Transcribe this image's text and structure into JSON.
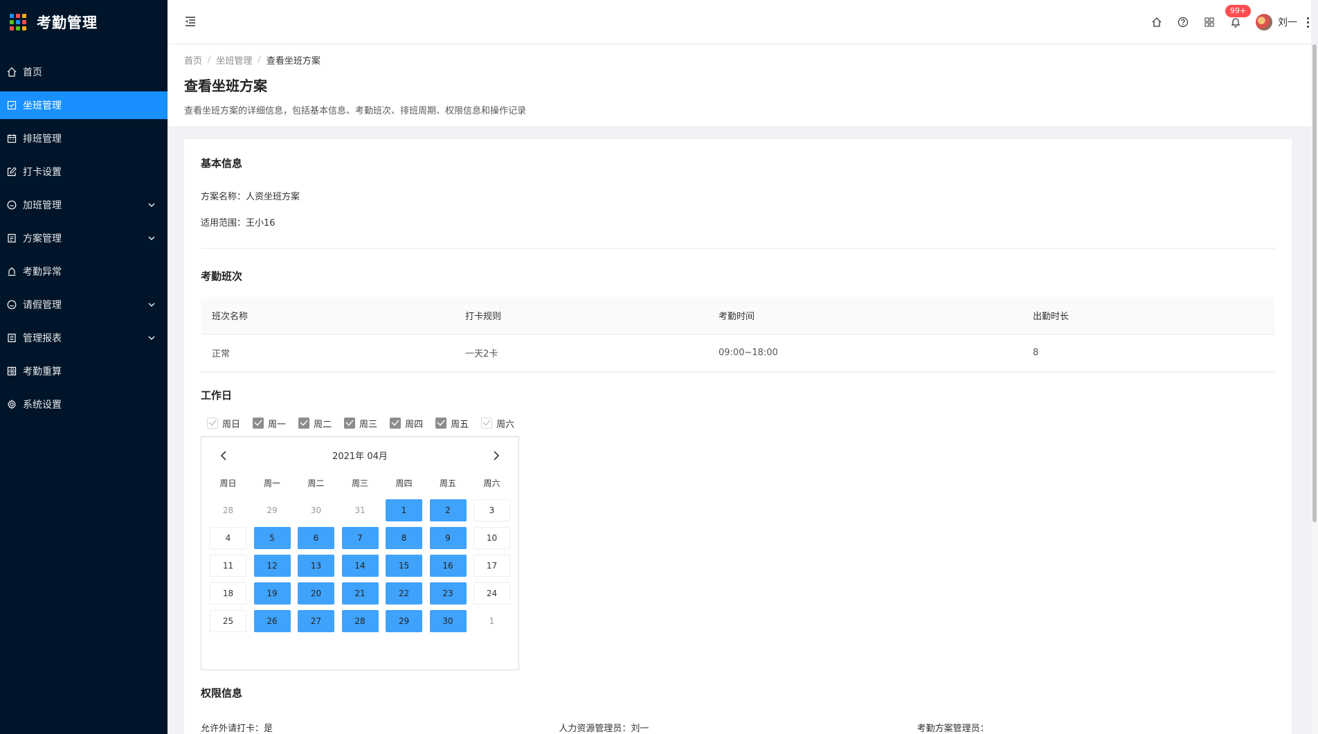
{
  "app": {
    "title": "考勤管理"
  },
  "sidebar": {
    "items": [
      {
        "label": "首页",
        "icon": "home-icon",
        "active": false,
        "has_arrow": false
      },
      {
        "label": "坐班管理",
        "icon": "check-square-icon",
        "active": true,
        "has_arrow": false
      },
      {
        "label": "排班管理",
        "icon": "calendar-icon",
        "active": false,
        "has_arrow": false
      },
      {
        "label": "打卡设置",
        "icon": "edit-icon",
        "active": false,
        "has_arrow": false
      },
      {
        "label": "加班管理",
        "icon": "clock-icon",
        "active": false,
        "has_arrow": true
      },
      {
        "label": "方案管理",
        "icon": "document-icon",
        "active": false,
        "has_arrow": true
      },
      {
        "label": "考勤异常",
        "icon": "alarm-icon",
        "active": false,
        "has_arrow": false
      },
      {
        "label": "请假管理",
        "icon": "smile-icon",
        "active": false,
        "has_arrow": true
      },
      {
        "label": "管理报表",
        "icon": "report-icon",
        "active": false,
        "has_arrow": true
      },
      {
        "label": "考勤重算",
        "icon": "calculator-icon",
        "active": false,
        "has_arrow": false
      },
      {
        "label": "系统设置",
        "icon": "gear-icon",
        "active": false,
        "has_arrow": false
      }
    ]
  },
  "header": {
    "notifications_badge": "99+",
    "username": "刘一"
  },
  "breadcrumb": {
    "home": "首页",
    "parent": "坐班管理",
    "current": "查看坐班方案",
    "separator": "/"
  },
  "page": {
    "title": "查看坐班方案",
    "description": "查看坐班方案的详细信息，包括基本信息、考勤班次、排班周期、权限信息和操作记录"
  },
  "basic_info": {
    "title": "基本信息",
    "name_label": "方案名称：",
    "name_value": "人资坐班方案",
    "scope_label": "适用范围：",
    "scope_value": "王小16"
  },
  "shift": {
    "title": "考勤班次",
    "columns": [
      "班次名称",
      "打卡规则",
      "考勤时间",
      "出勤时长"
    ],
    "rows": [
      [
        "正常",
        "一天2卡",
        "09:00~18:00",
        "8"
      ]
    ]
  },
  "workdays": {
    "title": "工作日",
    "options": [
      {
        "label": "周日",
        "checked": false
      },
      {
        "label": "周一",
        "checked": true
      },
      {
        "label": "周二",
        "checked": true
      },
      {
        "label": "周三",
        "checked": true
      },
      {
        "label": "周四",
        "checked": true
      },
      {
        "label": "周五",
        "checked": true
      },
      {
        "label": "周六",
        "checked": false
      }
    ]
  },
  "calendar": {
    "title": "2021年 04月",
    "dow": [
      "周日",
      "周一",
      "周二",
      "周三",
      "周四",
      "周五",
      "周六"
    ],
    "work_color": "#3fa2fb",
    "days": [
      {
        "d": "28",
        "type": "muted"
      },
      {
        "d": "29",
        "type": "muted"
      },
      {
        "d": "30",
        "type": "muted"
      },
      {
        "d": "31",
        "type": "muted"
      },
      {
        "d": "1",
        "type": "work"
      },
      {
        "d": "2",
        "type": "work"
      },
      {
        "d": "3",
        "type": "normal"
      },
      {
        "d": "4",
        "type": "normal"
      },
      {
        "d": "5",
        "type": "work"
      },
      {
        "d": "6",
        "type": "work"
      },
      {
        "d": "7",
        "type": "work"
      },
      {
        "d": "8",
        "type": "work"
      },
      {
        "d": "9",
        "type": "work"
      },
      {
        "d": "10",
        "type": "normal"
      },
      {
        "d": "11",
        "type": "normal"
      },
      {
        "d": "12",
        "type": "work"
      },
      {
        "d": "13",
        "type": "work"
      },
      {
        "d": "14",
        "type": "work"
      },
      {
        "d": "15",
        "type": "work"
      },
      {
        "d": "16",
        "type": "work"
      },
      {
        "d": "17",
        "type": "normal"
      },
      {
        "d": "18",
        "type": "normal"
      },
      {
        "d": "19",
        "type": "work"
      },
      {
        "d": "20",
        "type": "work"
      },
      {
        "d": "21",
        "type": "work"
      },
      {
        "d": "22",
        "type": "work"
      },
      {
        "d": "23",
        "type": "work"
      },
      {
        "d": "24",
        "type": "normal"
      },
      {
        "d": "25",
        "type": "normal"
      },
      {
        "d": "26",
        "type": "work"
      },
      {
        "d": "27",
        "type": "work"
      },
      {
        "d": "28",
        "type": "work"
      },
      {
        "d": "29",
        "type": "work"
      },
      {
        "d": "30",
        "type": "work"
      },
      {
        "d": "1",
        "type": "muted"
      }
    ]
  },
  "permissions": {
    "title": "权限信息",
    "items": [
      {
        "label": "允许外请打卡：",
        "value": "是"
      },
      {
        "label": "人力资源管理员：",
        "value": "刘一"
      },
      {
        "label": "考勤方案管理员：",
        "value": ""
      }
    ]
  },
  "colors": {
    "sidebar_bg": "#001529",
    "accent": "#1890ff",
    "badge": "#ff4d4f"
  }
}
